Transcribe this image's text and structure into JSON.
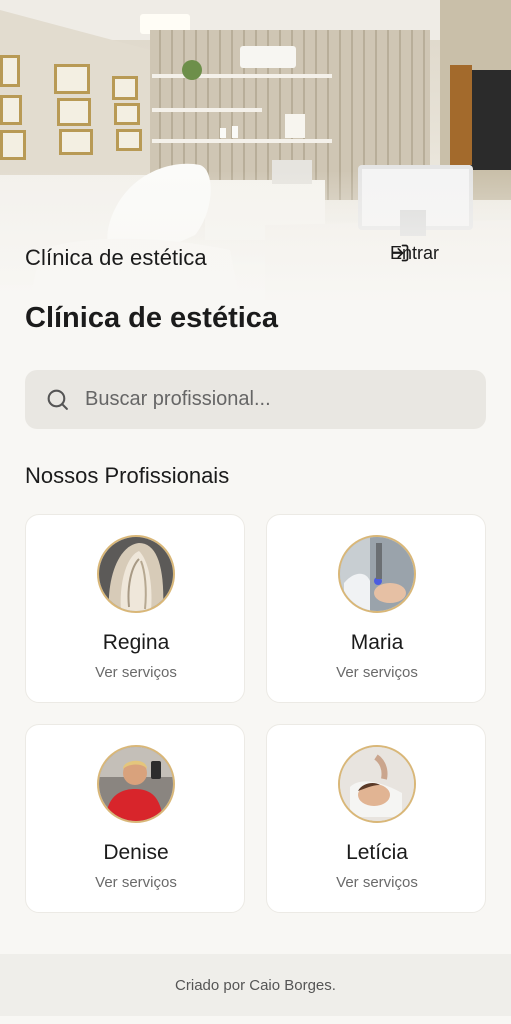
{
  "header": {
    "brand": "Clínica de estética",
    "login_label": "Entrar",
    "login_icon": "login-arrow-icon"
  },
  "main": {
    "title": "Clínica de estética",
    "search": {
      "placeholder": "Buscar profissional...",
      "value": "",
      "icon": "search-icon"
    },
    "section_title": "Nossos Profissionais",
    "professionals": [
      {
        "name": "Regina",
        "link": "Ver serviços"
      },
      {
        "name": "Maria",
        "link": "Ver serviços"
      },
      {
        "name": "Denise",
        "link": "Ver serviços"
      },
      {
        "name": "Letícia",
        "link": "Ver serviços"
      }
    ]
  },
  "footer": {
    "credit": "Criado por Caio Borges."
  },
  "colors": {
    "background": "#f8f7f4",
    "card": "#ffffff",
    "search_bg": "#e9e7e2",
    "avatar_border": "#d9b778",
    "footer_bg": "#efeeea"
  }
}
